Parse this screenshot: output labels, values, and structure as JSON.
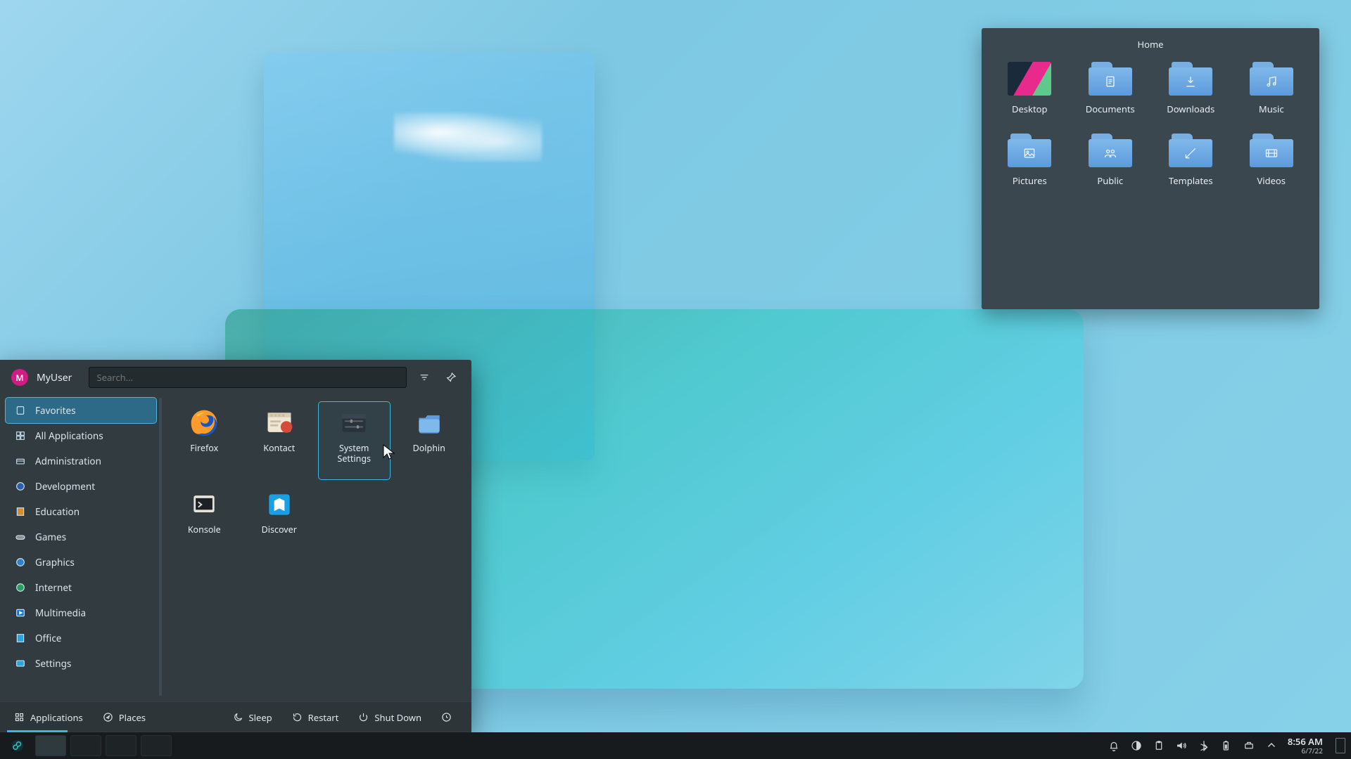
{
  "colors": {
    "accent": "#39b6e3",
    "panel": "#171b1d",
    "menu": "#313b40",
    "widget": "#3a474e",
    "avatar": "#d11c84"
  },
  "homeWidget": {
    "title": "Home",
    "items": [
      {
        "label": "Desktop",
        "iconName": "desktop-thumb-icon",
        "kind": "desktop"
      },
      {
        "label": "Documents",
        "iconName": "documents-icon"
      },
      {
        "label": "Downloads",
        "iconName": "downloads-icon"
      },
      {
        "label": "Music",
        "iconName": "music-icon"
      },
      {
        "label": "Pictures",
        "iconName": "pictures-icon"
      },
      {
        "label": "Public",
        "iconName": "public-icon"
      },
      {
        "label": "Templates",
        "iconName": "templates-icon"
      },
      {
        "label": "Videos",
        "iconName": "videos-icon"
      }
    ]
  },
  "start": {
    "user": {
      "initial": "M",
      "name": "MyUser"
    },
    "search": {
      "placeholder": "Search...",
      "value": ""
    },
    "headerIcons": [
      {
        "name": "filter-icon"
      },
      {
        "name": "pin-icon"
      }
    ],
    "categories": [
      {
        "name": "favorites",
        "label": "Favorites",
        "icon": "bookmark-icon",
        "active": true
      },
      {
        "name": "all-applications",
        "label": "All Applications",
        "icon": "grid-icon"
      },
      {
        "name": "administration",
        "label": "Administration",
        "icon": "admin-icon"
      },
      {
        "name": "development",
        "label": "Development",
        "icon": "dev-icon"
      },
      {
        "name": "education",
        "label": "Education",
        "icon": "book-icon"
      },
      {
        "name": "games",
        "label": "Games",
        "icon": "gamepad-icon"
      },
      {
        "name": "graphics",
        "label": "Graphics",
        "icon": "palette-icon"
      },
      {
        "name": "internet",
        "label": "Internet",
        "icon": "globe-icon"
      },
      {
        "name": "multimedia",
        "label": "Multimedia",
        "icon": "play-icon"
      },
      {
        "name": "office",
        "label": "Office",
        "icon": "office-icon"
      },
      {
        "name": "settings",
        "label": "Settings",
        "icon": "settings-cat-icon"
      }
    ],
    "apps": [
      {
        "name": "firefox",
        "label": "Firefox",
        "icon": "firefox-icon"
      },
      {
        "name": "kontact",
        "label": "Kontact",
        "icon": "kontact-icon"
      },
      {
        "name": "system-settings",
        "label": "System Settings",
        "icon": "settings-icon",
        "selected": true
      },
      {
        "name": "dolphin",
        "label": "Dolphin",
        "icon": "dolphin-icon"
      },
      {
        "name": "konsole",
        "label": "Konsole",
        "icon": "konsole-icon"
      },
      {
        "name": "discover",
        "label": "Discover",
        "icon": "discover-icon"
      }
    ],
    "footer": {
      "left": [
        {
          "name": "applications-tab",
          "label": "Applications",
          "icon": "apps-icon",
          "active": true
        },
        {
          "name": "places-tab",
          "label": "Places",
          "icon": "compass-icon"
        }
      ],
      "right": [
        {
          "name": "sleep-button",
          "label": "Sleep",
          "icon": "moon-icon"
        },
        {
          "name": "restart-button",
          "label": "Restart",
          "icon": "restart-icon"
        },
        {
          "name": "shutdown-button",
          "label": "Shut Down",
          "icon": "power-icon"
        },
        {
          "name": "leave-more-button",
          "label": "",
          "icon": "more-icon"
        }
      ]
    }
  },
  "panel": {
    "launcherIcon": "fedora-icon",
    "tasks": [
      {
        "name": "task-konsole",
        "icon": "konsole-icon",
        "active": true
      },
      {
        "name": "task-settings",
        "icon": "settings-task-icon"
      },
      {
        "name": "task-dolphin",
        "icon": "dolphin-task-icon"
      },
      {
        "name": "task-firefox",
        "icon": "firefox-icon"
      }
    ],
    "tray": [
      {
        "name": "notifications-icon"
      },
      {
        "name": "night-color-icon"
      },
      {
        "name": "clipboard-icon"
      },
      {
        "name": "volume-icon"
      },
      {
        "name": "bluetooth-icon"
      },
      {
        "name": "battery-icon"
      },
      {
        "name": "network-icon"
      },
      {
        "name": "tray-expand-icon"
      }
    ],
    "clock": {
      "time": "8:56 AM",
      "date": "6/7/22"
    }
  }
}
